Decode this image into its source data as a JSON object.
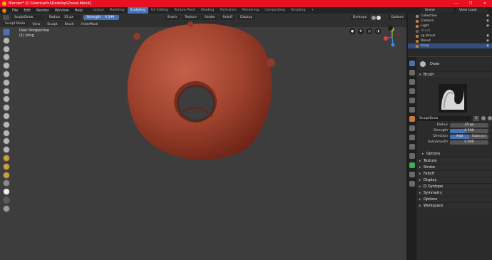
{
  "titlebar": {
    "text": "Blender* [C:\\Users\\wllci\\Desktop\\Donut.blend]",
    "buttons": [
      "—",
      "❐",
      "✕"
    ]
  },
  "menubar": {
    "menus": [
      "File",
      "Edit",
      "Render",
      "Window",
      "Help"
    ],
    "workspaces": [
      "Layout",
      "Modeling",
      "Sculpting",
      "UV Editing",
      "Texture Paint",
      "Shading",
      "Animation",
      "Rendering",
      "Compositing",
      "Scripting"
    ],
    "active_workspace": "Sculpting",
    "add_tab": "+",
    "scene": "Scene",
    "view_layer": "View Layer"
  },
  "toolheader": {
    "brush": "SculptDraw",
    "radius_label": "Radius",
    "radius_value": "35 px",
    "strength_label": "Strength",
    "strength_value": "0.599",
    "menus": [
      "Brush",
      "Texture",
      "Stroke",
      "Falloff",
      "Display"
    ],
    "dyntopo": "Dyntopo",
    "options": "Options"
  },
  "header2": {
    "mode": "Sculpt Mode",
    "menus": [
      "View",
      "Sculpt",
      "Brush",
      "Hide/Mask"
    ]
  },
  "viewport": {
    "perspective": "User Perspective",
    "object": "(1) Icing"
  },
  "outliner": {
    "items": [
      {
        "label": "Collection",
        "color": "#8a8a8a",
        "selected": false
      },
      {
        "label": "Camera",
        "color": "#c47c3a",
        "selected": false
      },
      {
        "label": "Light",
        "color": "#c47c3a",
        "selected": false
      },
      {
        "label": "donut",
        "color": "#666666",
        "selected": false
      },
      {
        "label": "sg.donut",
        "color": "#c47c3a",
        "selected": false
      },
      {
        "label": "Donut",
        "color": "#c47c3a",
        "selected": false
      },
      {
        "label": "Icing",
        "color": "#c47c3a",
        "selected": true
      }
    ]
  },
  "properties": {
    "tool_name": "Draw",
    "brush_panel": "Brush",
    "brush_name": "SculptDraw",
    "brush_users": "2",
    "radius_label": "Radius",
    "radius_value": "35 px",
    "strength_label": "Strength",
    "strength_value": "0.599",
    "direction_label": "Direction",
    "direction_add": "Add",
    "direction_subtract": "Subtract",
    "autosmooth_label": "Autosmooth",
    "autosmooth_value": "0.000",
    "panels": [
      "Options",
      "Texture",
      "Stroke",
      "Falloff",
      "Display",
      "Dyntopo",
      "Symmetry",
      "Options",
      "Workspace"
    ]
  },
  "colors": {
    "accent": "#4772b3",
    "titlebar": "#e81123",
    "donut": "#9a3d2a"
  }
}
